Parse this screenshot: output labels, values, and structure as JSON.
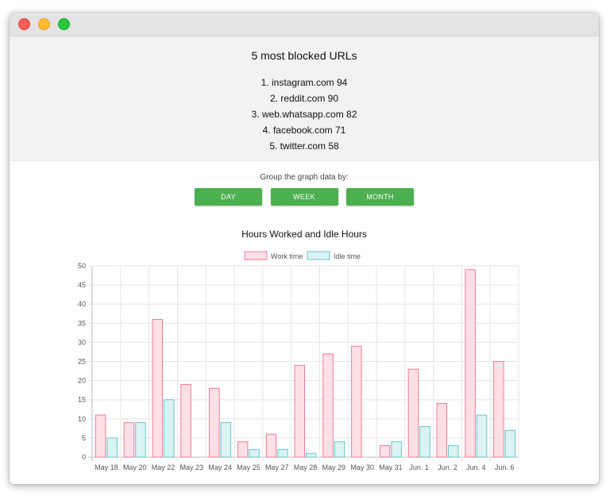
{
  "blocked": {
    "title": "5 most blocked URLs",
    "items": [
      "1. instagram.com 94",
      "2. reddit.com 90",
      "3. web.whatsapp.com 82",
      "4. facebook.com 71",
      "5. twitter.com 58"
    ]
  },
  "grouping": {
    "label": "Group the graph data by:",
    "day": "DAY",
    "week": "WEEK",
    "month": "MONTH"
  },
  "colors": {
    "button": "#4caf50",
    "work_fill": "#fde0e6",
    "work_stroke": "#f07b93",
    "idle_fill": "#dbf3f3",
    "idle_stroke": "#66c8cc"
  },
  "chart_data": {
    "type": "bar",
    "title": "Hours Worked and Idle Hours",
    "categories": [
      "May 18",
      "May 20",
      "May 22",
      "May 23",
      "May 24",
      "May 25",
      "May 27",
      "May 28",
      "May 29",
      "May 30",
      "May 31",
      "Jun. 1",
      "Jun. 2",
      "Jun. 4",
      "Jun. 6"
    ],
    "series": [
      {
        "name": "Work time",
        "values": [
          11,
          9,
          36,
          19,
          18,
          4,
          6,
          24,
          27,
          29,
          3,
          23,
          14,
          49,
          25
        ]
      },
      {
        "name": "Idle time",
        "values": [
          5,
          9,
          15,
          0,
          9,
          2,
          2,
          1,
          4,
          0,
          4,
          8,
          3,
          11,
          7
        ]
      }
    ],
    "ylim": [
      0,
      50
    ],
    "yticks": [
      0,
      5,
      10,
      15,
      20,
      25,
      30,
      35,
      40,
      45,
      50
    ],
    "grid": true,
    "legend": "top"
  }
}
